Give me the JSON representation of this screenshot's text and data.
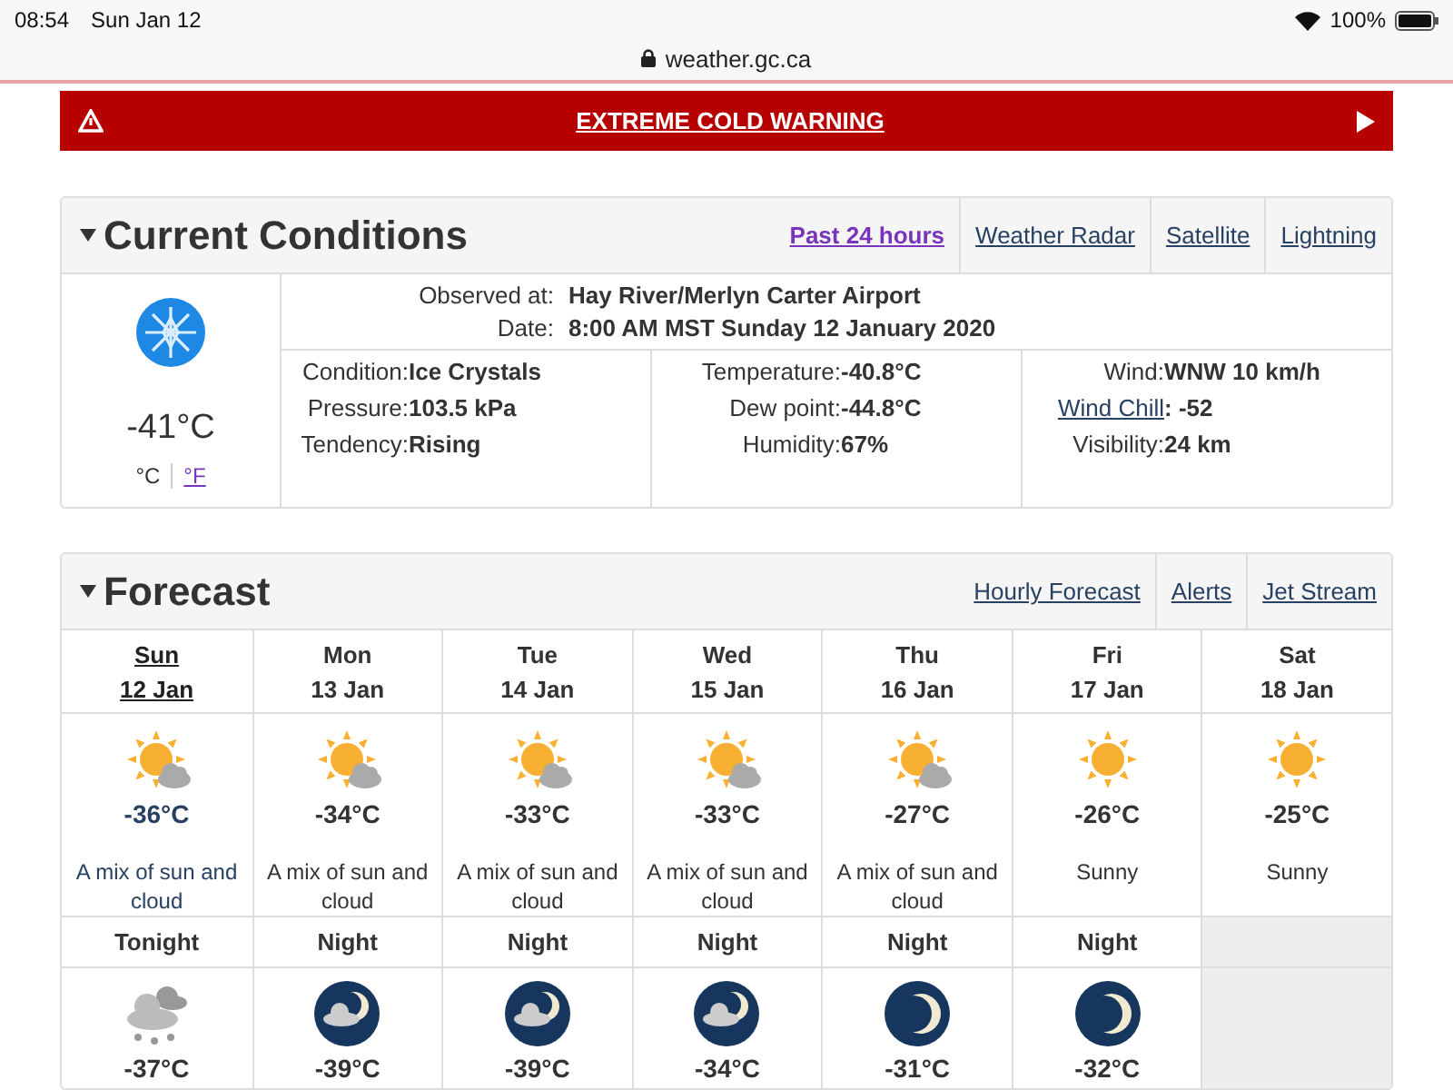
{
  "status_bar": {
    "time": "08:54",
    "date": "Sun Jan 12",
    "battery": "100%"
  },
  "address_bar": {
    "url": "weather.gc.ca"
  },
  "alert": {
    "title": "EXTREME COLD WARNING"
  },
  "current_conditions": {
    "title": "Current Conditions",
    "links": [
      {
        "label": "Past 24 hours",
        "visited": true
      },
      {
        "label": "Weather Radar",
        "visited": false
      },
      {
        "label": "Satellite",
        "visited": false
      },
      {
        "label": "Lightning",
        "visited": false
      }
    ],
    "temperature": "-41°C",
    "units": [
      {
        "label": "°C",
        "selected": true
      },
      {
        "label": "°F",
        "selected": false
      }
    ],
    "observation": [
      {
        "label": "Observed at:",
        "value": "Hay River/Merlyn Carter Airport"
      },
      {
        "label": "Date:",
        "value": "8:00 AM MST Sunday 12 January 2020"
      }
    ],
    "details": [
      [
        {
          "label": "Condition:",
          "value": "Ice Crystals",
          "kind": "text"
        },
        {
          "label": "Pressure:",
          "value": "103.5 kPa",
          "kind": "text"
        },
        {
          "label": "Tendency:",
          "value": "Rising",
          "kind": "text"
        }
      ],
      [
        {
          "label": "Temperature:",
          "value": "-40.8°C",
          "kind": "text"
        },
        {
          "label": "Dew point:",
          "value": "-44.8°C",
          "kind": "text"
        },
        {
          "label": "Humidity:",
          "value": "67%",
          "kind": "text"
        }
      ],
      [
        {
          "label": "Wind:",
          "value": "WNW 10 km/h",
          "kind": "text"
        },
        {
          "label": "Wind Chill",
          "value": ": -52",
          "kind": "link"
        },
        {
          "label": "Visibility:",
          "value": "24 km",
          "kind": "text"
        }
      ]
    ]
  },
  "forecast": {
    "title": "Forecast",
    "links": [
      {
        "label": "Hourly Forecast",
        "visited": false
      },
      {
        "label": "Alerts",
        "visited": false
      },
      {
        "label": "Jet Stream",
        "visited": false
      }
    ],
    "days": [
      {
        "day": "Sun",
        "date": "12 Jan",
        "selected": true,
        "kind": "sun-cloud",
        "temp": "-36°C",
        "summary": "A mix of sun and cloud"
      },
      {
        "day": "Mon",
        "date": "13 Jan",
        "selected": false,
        "kind": "sun-cloud",
        "temp": "-34°C",
        "summary": "A mix of sun and cloud"
      },
      {
        "day": "Tue",
        "date": "14 Jan",
        "selected": false,
        "kind": "sun-cloud",
        "temp": "-33°C",
        "summary": "A mix of sun and cloud"
      },
      {
        "day": "Wed",
        "date": "15 Jan",
        "selected": false,
        "kind": "sun-cloud",
        "temp": "-33°C",
        "summary": "A mix of sun and cloud"
      },
      {
        "day": "Thu",
        "date": "16 Jan",
        "selected": false,
        "kind": "sun-cloud",
        "temp": "-27°C",
        "summary": "A mix of sun and cloud"
      },
      {
        "day": "Fri",
        "date": "17 Jan",
        "selected": false,
        "kind": "sun",
        "temp": "-26°C",
        "summary": "Sunny"
      },
      {
        "day": "Sat",
        "date": "18 Jan",
        "selected": false,
        "kind": "sun",
        "temp": "-25°C",
        "summary": "Sunny"
      }
    ],
    "nights": [
      {
        "label": "Tonight",
        "kind": "snow-cloud",
        "temp": "-37°C"
      },
      {
        "label": "Night",
        "kind": "night-cloud",
        "temp": "-39°C"
      },
      {
        "label": "Night",
        "kind": "night-cloud",
        "temp": "-39°C"
      },
      {
        "label": "Night",
        "kind": "night-cloud",
        "temp": "-34°C"
      },
      {
        "label": "Night",
        "kind": "night-clear",
        "temp": "-31°C"
      },
      {
        "label": "Night",
        "kind": "night-clear",
        "temp": "-32°C"
      }
    ]
  }
}
